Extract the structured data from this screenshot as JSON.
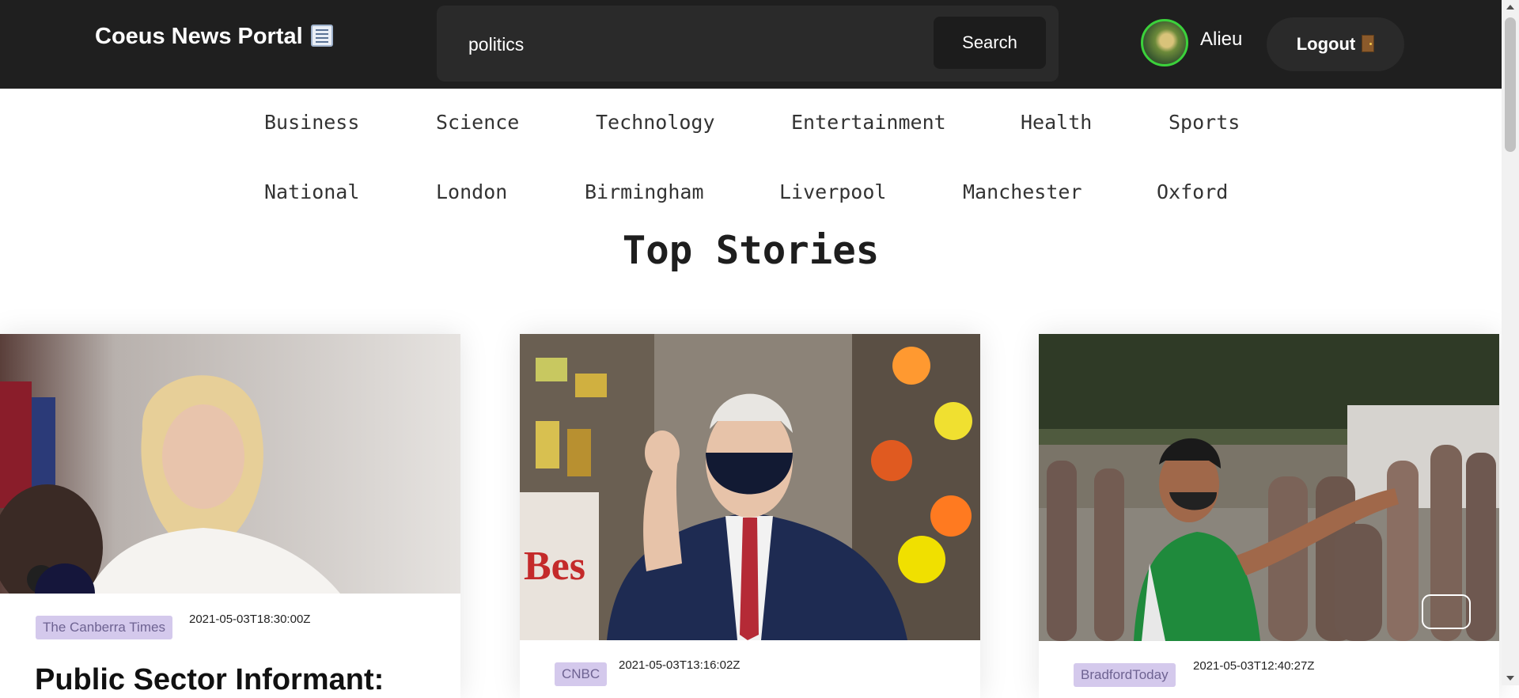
{
  "header": {
    "brand": "Coeus News Portal",
    "brand_icon": "newspaper-icon",
    "search_value": "politics",
    "search_button": "Search",
    "username": "Alieu",
    "logout_label": "Logout",
    "logout_icon": "door-icon",
    "accent_color": "#3bd13b"
  },
  "nav": {
    "row1": [
      "Business",
      "Science",
      "Technology",
      "Entertainment",
      "Health",
      "Sports"
    ],
    "row2": [
      "National",
      "London",
      "Birmingham",
      "Liverpool",
      "Manchester",
      "Oxford"
    ]
  },
  "main": {
    "title": "Top Stories",
    "cards": [
      {
        "source": "The Canberra Times",
        "date": "2021-05-03T18:30:00Z",
        "headline": "Public Sector Informant:"
      },
      {
        "source": "CNBC",
        "date": "2021-05-03T13:16:02Z"
      },
      {
        "source": "BradfordToday",
        "date": "2021-05-03T12:40:27Z"
      }
    ]
  }
}
